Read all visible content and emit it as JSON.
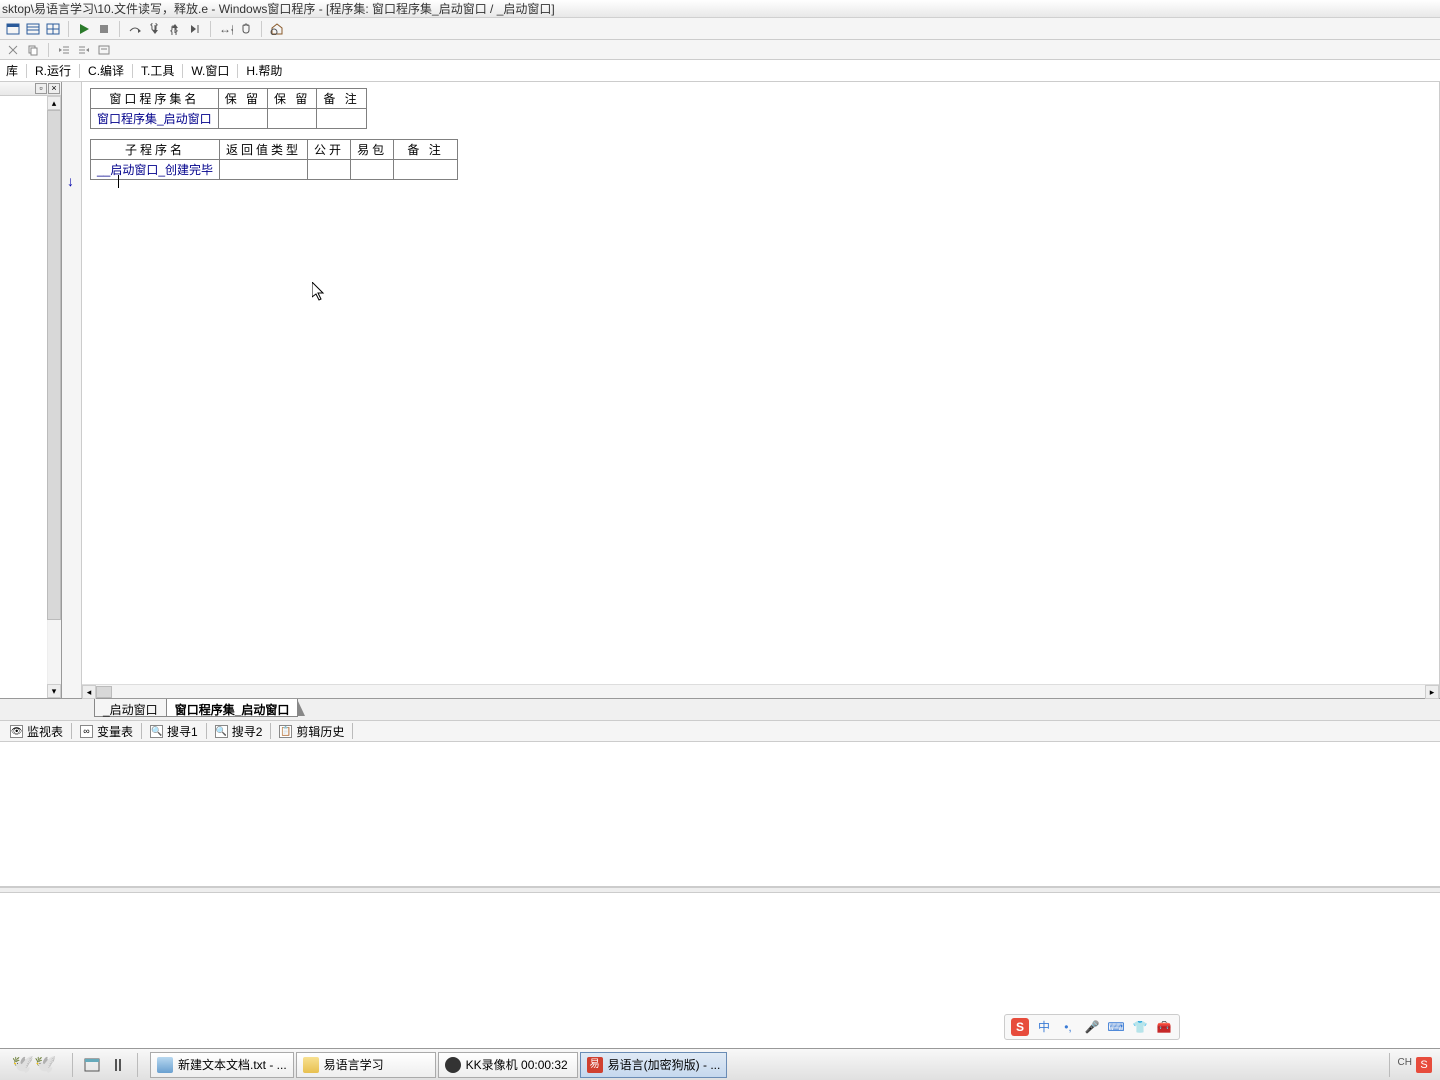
{
  "title": "sktop\\易语言学习\\10.文件读写，释放.e - Windows窗口程序 - [程序集: 窗口程序集_启动窗口 / _启动窗口]",
  "menu": {
    "m0": "库",
    "m1": "R.运行",
    "m2": "C.编译",
    "m3": "T.工具",
    "m4": "W.窗口",
    "m5": "H.帮助"
  },
  "table1": {
    "h1": "窗口程序集名",
    "h2": "保 留",
    "h3": "保 留",
    "h4": "备 注",
    "r1c1": "窗口程序集_启动窗口",
    "r1c2": "",
    "r1c3": "",
    "r1c4": ""
  },
  "table2": {
    "h1": "子程序名",
    "h2": "返回值类型",
    "h3": "公开",
    "h4": "易包",
    "h5": "备 注",
    "r1c1": "__启动窗口_创建完毕",
    "r1c2": "",
    "r1c3": "",
    "r1c4": "",
    "r1c5": ""
  },
  "bottom_tabs": {
    "t1": "_启动窗口",
    "t2": "窗口程序集_启动窗口"
  },
  "util_tabs": {
    "u1": "监视表",
    "u2": "变量表",
    "u3": "搜寻1",
    "u4": "搜寻2",
    "u5": "剪辑历史"
  },
  "ime": {
    "mode": "中"
  },
  "taskbar": {
    "i1": "新建文本文档.txt - ...",
    "i2": "易语言学习",
    "i3": "KK录像机 00:00:32",
    "i4": "易语言(加密狗版) - ..."
  },
  "tray": {
    "lang": "CH"
  }
}
